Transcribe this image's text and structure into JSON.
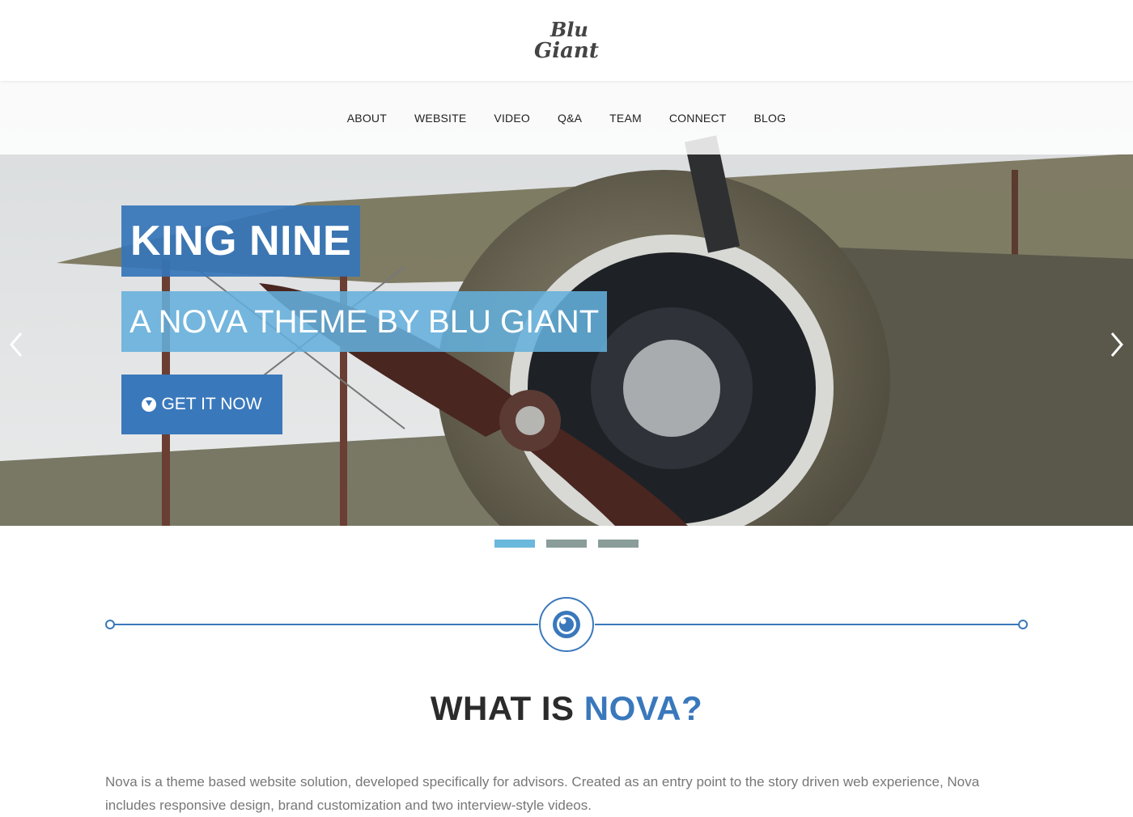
{
  "logo": {
    "line1": "Blu",
    "line2": "Giant"
  },
  "nav": {
    "items": [
      "ABOUT",
      "WEBSITE",
      "VIDEO",
      "Q&A",
      "TEAM",
      "CONNECT",
      "BLOG"
    ]
  },
  "hero": {
    "title": "KING NINE",
    "subtitle": "A NOVA THEME BY BLU GIANT",
    "cta_label": "GET IT NOW",
    "cta_icon": "download-circle-icon"
  },
  "slider": {
    "slide_count": 3,
    "active_index": 0
  },
  "divider": {
    "icon": "eye-icon"
  },
  "section": {
    "title_plain": "WHAT IS ",
    "title_accent": "NOVA?",
    "body": "Nova is a theme based website solution, developed specifically for advisors. Created as an entry point to the story driven web experience, Nova includes responsive design, brand customization and two interview-style videos."
  },
  "colors": {
    "primary": "#3a78bc",
    "light_blue": "#6bb8dd",
    "dot_inactive": "#8a9d98",
    "text_gray": "#777777"
  }
}
